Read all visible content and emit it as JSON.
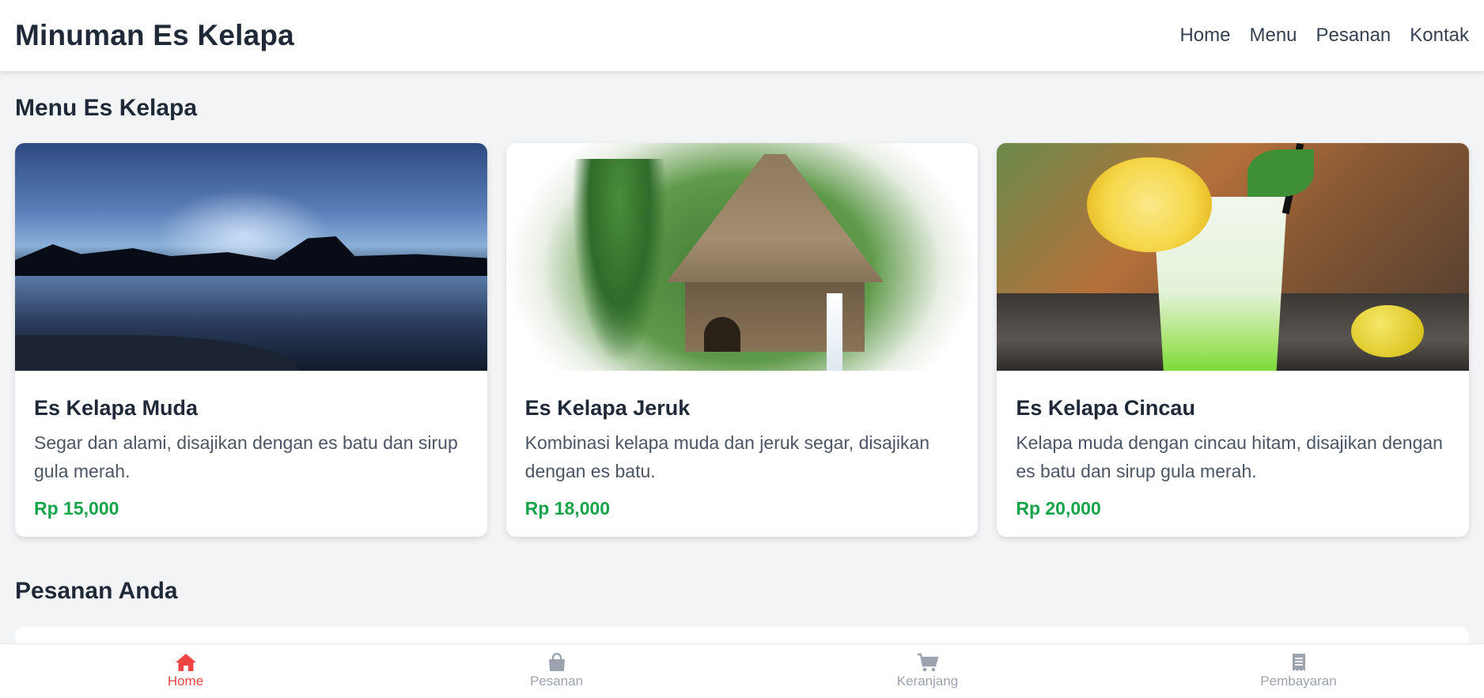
{
  "header": {
    "brand": "Minuman Es Kelapa",
    "nav": [
      "Home",
      "Menu",
      "Pesanan",
      "Kontak"
    ]
  },
  "menu_section": {
    "title": "Menu Es Kelapa",
    "items": [
      {
        "name": "Es Kelapa Muda",
        "description": "Segar dan alami, disajikan dengan es batu dan sirup gula merah.",
        "price": "Rp 15,000"
      },
      {
        "name": "Es Kelapa Jeruk",
        "description": "Kombinasi kelapa muda dan jeruk segar, disajikan dengan es batu.",
        "price": "Rp 18,000"
      },
      {
        "name": "Es Kelapa Cincau",
        "description": "Kelapa muda dengan cincau hitam, disajikan dengan es batu dan sirup gula merah.",
        "price": "Rp 20,000"
      }
    ]
  },
  "orders_section": {
    "title": "Pesanan Anda"
  },
  "bottom_nav": {
    "active": "Home",
    "items": [
      {
        "label": "Home",
        "icon": "home-icon"
      },
      {
        "label": "Pesanan",
        "icon": "shopping-bag-icon"
      },
      {
        "label": "Keranjang",
        "icon": "cart-icon"
      },
      {
        "label": "Pembayaran",
        "icon": "receipt-icon"
      }
    ]
  },
  "colors": {
    "accent": "#ef4444",
    "price": "#16a34a",
    "text": "#1f2937",
    "background": "#f3f4f6"
  }
}
